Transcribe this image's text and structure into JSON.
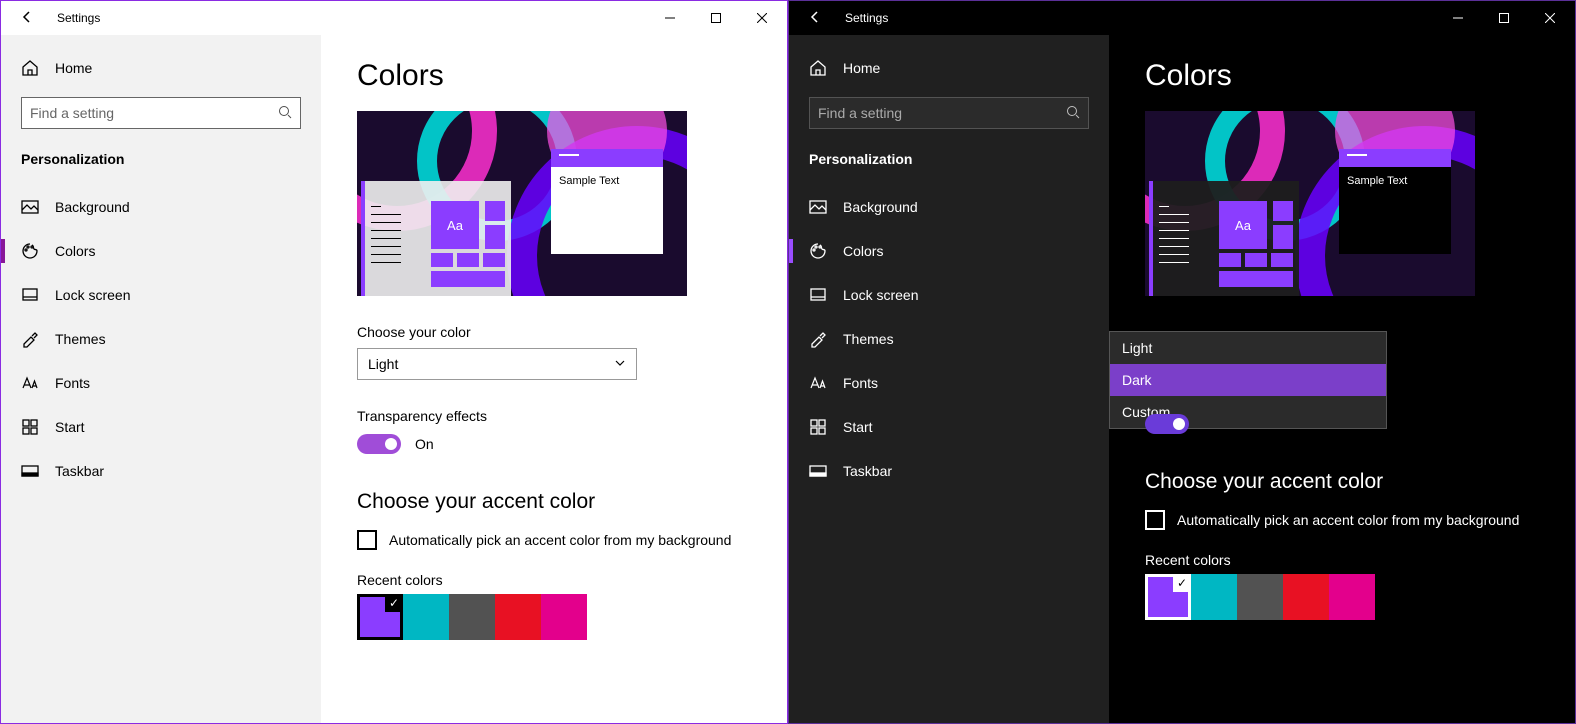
{
  "app_title": "Settings",
  "home_label": "Home",
  "search_placeholder": "Find a setting",
  "section": "Personalization",
  "nav": {
    "background": "Background",
    "colors": "Colors",
    "lockscreen": "Lock screen",
    "themes": "Themes",
    "fonts": "Fonts",
    "start": "Start",
    "taskbar": "Taskbar"
  },
  "page_title": "Colors",
  "preview": {
    "sample_text": "Sample Text",
    "tile_aa": "Aa"
  },
  "choose_color_label": "Choose your color",
  "light_selected": "Light",
  "dropdown_options": {
    "light": "Light",
    "dark": "Dark",
    "custom": "Custom"
  },
  "transparency_label": "Transparency effects",
  "transparency_state": "On",
  "accent_heading": "Choose your accent color",
  "auto_accent_label": "Automatically pick an accent color from my background",
  "recent_label": "Recent colors",
  "swatches": {
    "c0": "#8b3dff",
    "c1": "#00b7c3",
    "c2": "#525252",
    "c3": "#e81123",
    "c4": "#e3008c"
  }
}
